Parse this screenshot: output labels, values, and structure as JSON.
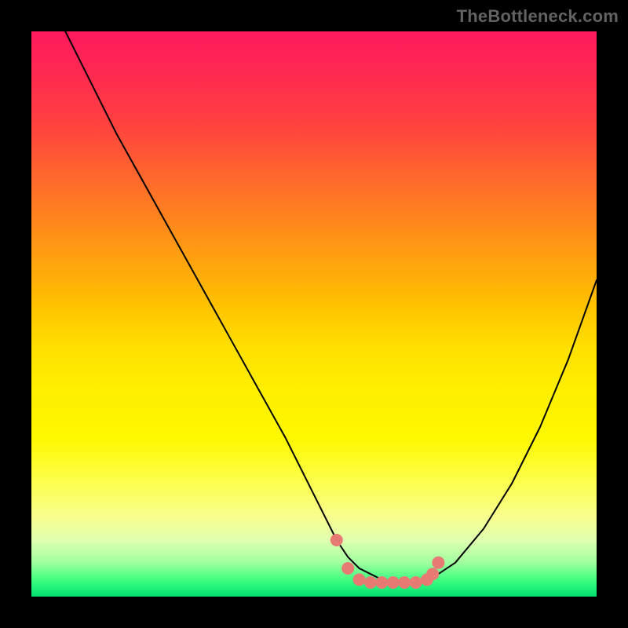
{
  "attribution": "TheBottleneck.com",
  "colors": {
    "background": "#000000",
    "gradient_top": "#ff1a5e",
    "gradient_bottom": "#00e070",
    "curve_stroke": "#000000",
    "marker_fill": "#e77b74"
  },
  "chart_data": {
    "type": "line",
    "title": "",
    "xlabel": "",
    "ylabel": "",
    "xlim": [
      0,
      100
    ],
    "ylim": [
      0,
      100
    ],
    "series": [
      {
        "name": "bottleneck-curve",
        "x": [
          6,
          10,
          15,
          20,
          25,
          30,
          35,
          40,
          45,
          50,
          52,
          54,
          56,
          58,
          60,
          62,
          64,
          66,
          68,
          70,
          72,
          75,
          80,
          85,
          90,
          95,
          100
        ],
        "values": [
          100,
          92,
          82,
          73,
          64,
          55,
          46,
          37,
          28,
          18,
          14,
          10,
          7,
          5,
          4,
          3,
          2.5,
          2.5,
          2.5,
          3,
          4,
          6,
          12,
          20,
          30,
          42,
          56
        ]
      }
    ],
    "markers": {
      "name": "highlight-dots",
      "x": [
        54,
        56,
        58,
        60,
        62,
        64,
        66,
        68,
        70,
        71,
        72
      ],
      "values": [
        10,
        5,
        3,
        2.5,
        2.5,
        2.5,
        2.5,
        2.5,
        3,
        4,
        6
      ]
    }
  }
}
